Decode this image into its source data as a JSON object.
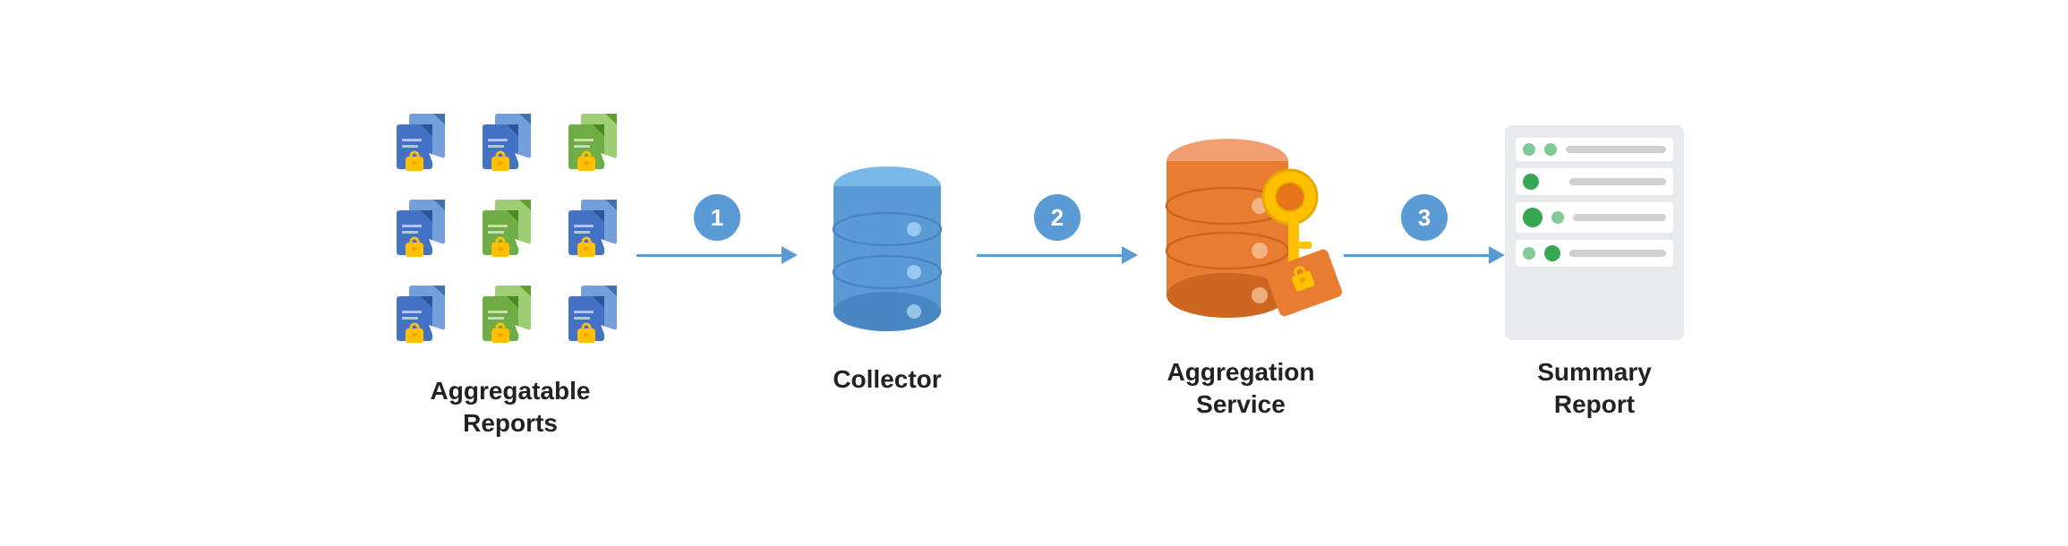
{
  "diagram": {
    "nodes": [
      {
        "id": "aggregatable-reports",
        "label_line1": "Aggregatable",
        "label_line2": "Reports"
      },
      {
        "id": "collector",
        "label_line1": "Collector",
        "label_line2": ""
      },
      {
        "id": "aggregation-service",
        "label_line1": "Aggregation",
        "label_line2": "Service"
      },
      {
        "id": "summary-report",
        "label_line1": "Summary",
        "label_line2": "Report"
      }
    ],
    "arrows": [
      {
        "id": "arrow-1",
        "badge": "1"
      },
      {
        "id": "arrow-2",
        "badge": "2"
      },
      {
        "id": "arrow-3",
        "badge": "3"
      }
    ],
    "colors": {
      "arrow_blue": "#5b9bd5",
      "badge_blue": "#5b9bd5",
      "collector_blue": "#5b9bd5",
      "aggregation_orange": "#e8751a",
      "doc_blue": "#4472c4",
      "doc_green": "#70ad47",
      "lock_yellow": "#ffc000",
      "key_yellow": "#ffc000",
      "summary_bg": "#e8eaed",
      "dot_green_dark": "#34a853",
      "dot_green_light": "#81c995"
    }
  }
}
